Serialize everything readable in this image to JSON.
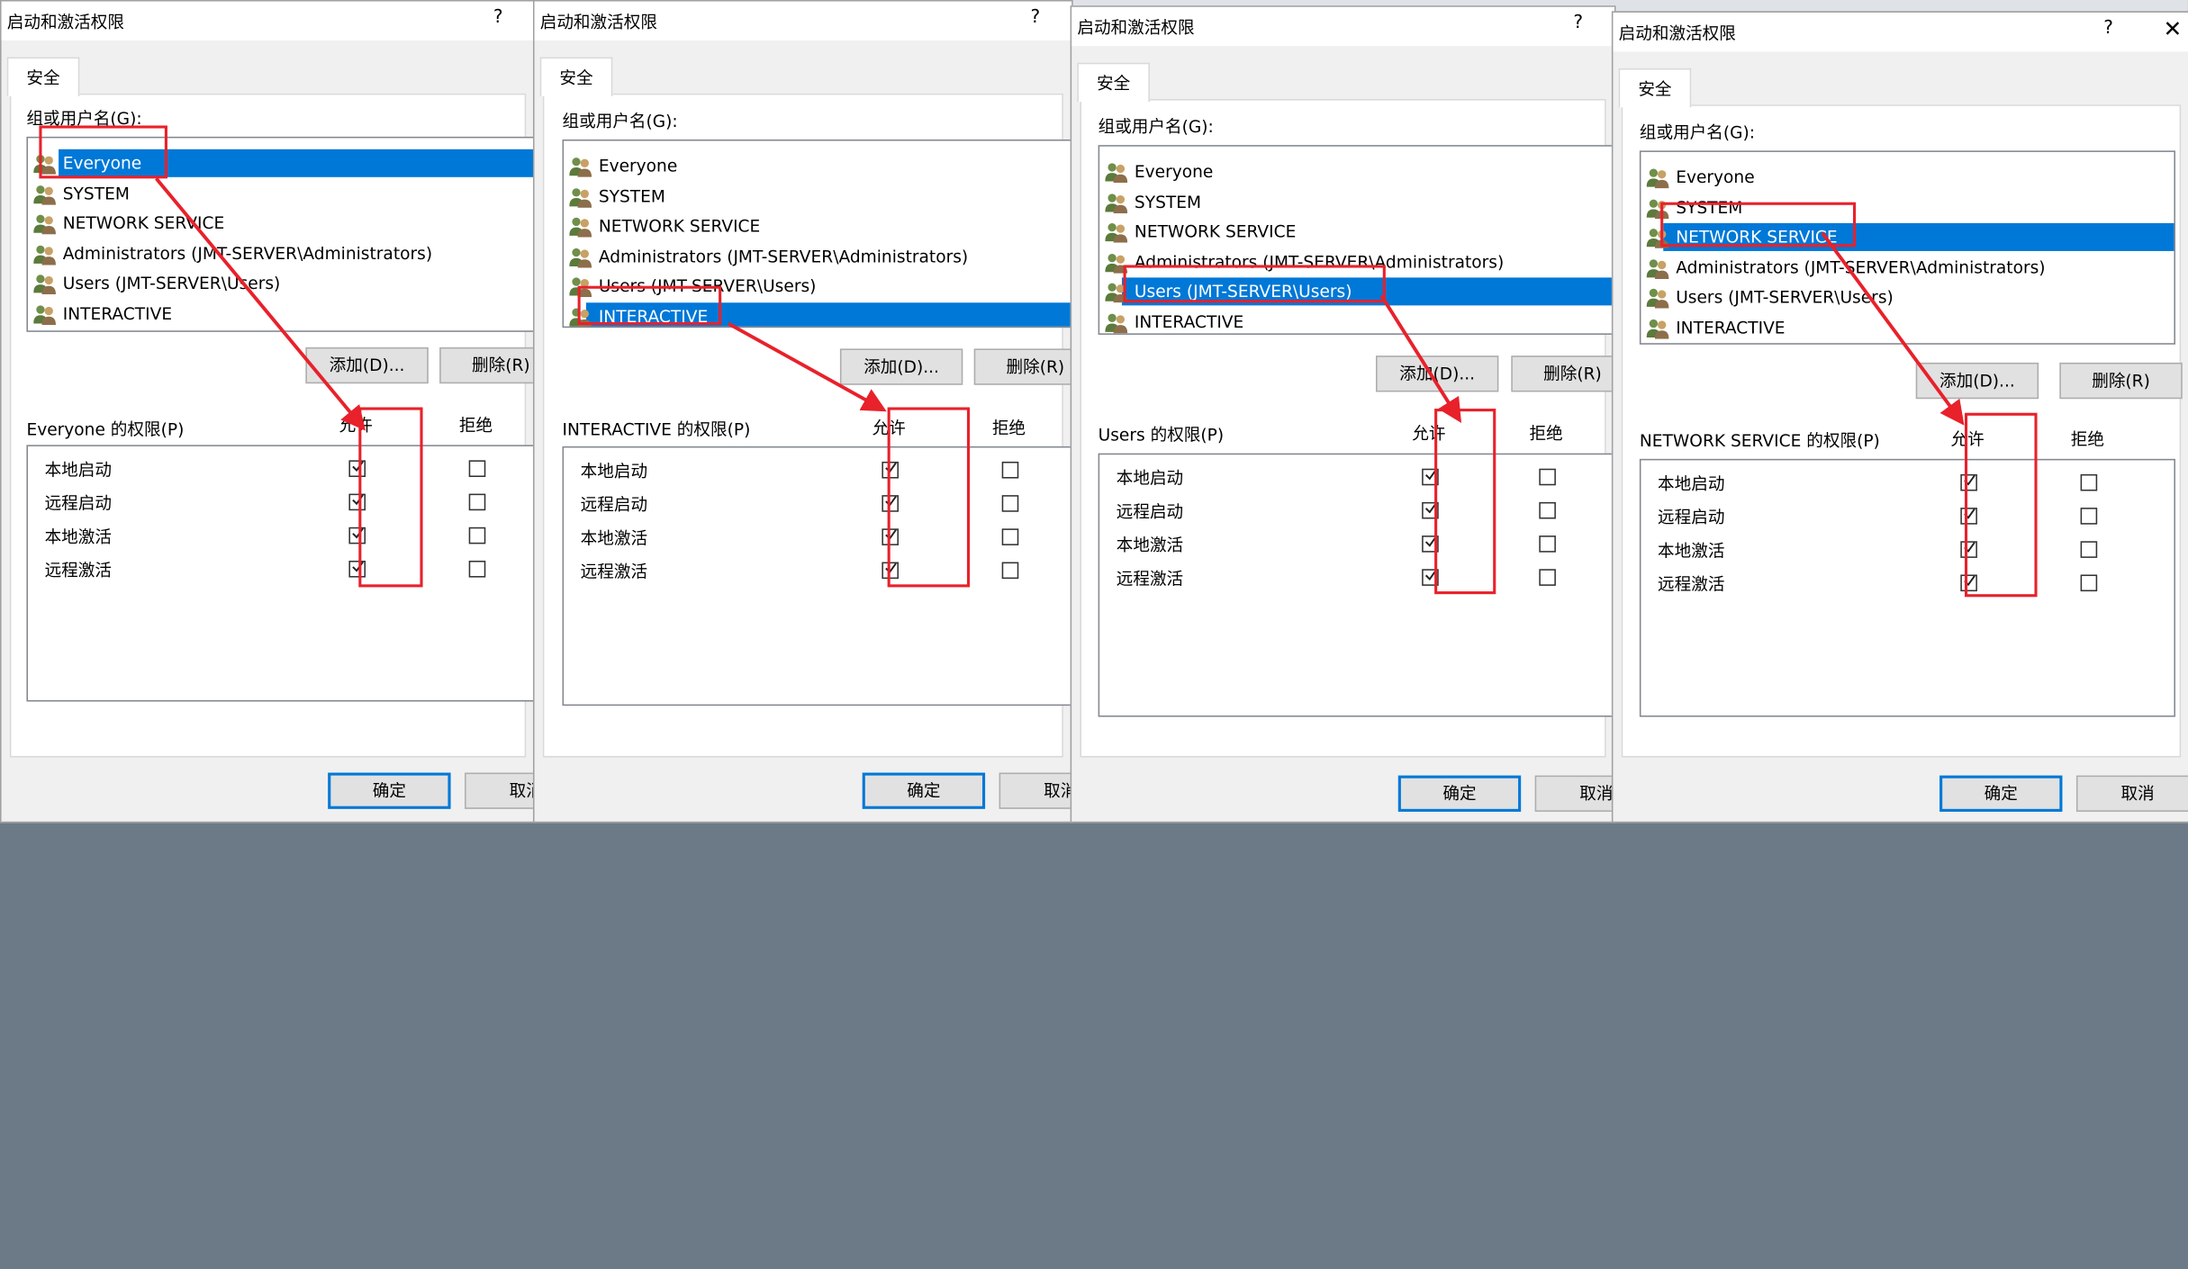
{
  "dialogs": [
    {
      "title": "启动和激活权限",
      "help": "?",
      "tab": "安全",
      "group_label": "组或用户名(G):",
      "users": [
        "Everyone",
        "SYSTEM",
        "NETWORK SERVICE",
        "Administrators (JMT-SERVER\\Administrators)",
        "Users (JMT-SERVER\\Users)",
        "INTERACTIVE"
      ],
      "selected": 0,
      "add": "添加(D)...",
      "remove": "删除(R)",
      "perm_label": "Everyone 的权限(P)",
      "allow": "允许",
      "deny": "拒绝",
      "perms": [
        "本地启动",
        "远程启动",
        "本地激活",
        "远程激活"
      ],
      "ok": "确定",
      "cancel": "取消"
    },
    {
      "title": "启动和激活权限",
      "help": "?",
      "tab": "安全",
      "group_label": "组或用户名(G):",
      "users": [
        "Everyone",
        "SYSTEM",
        "NETWORK SERVICE",
        "Administrators (JMT-SERVER\\Administrators)",
        "Users (JMT-SERVER\\Users)",
        "INTERACTIVE"
      ],
      "selected": 5,
      "add": "添加(D)...",
      "remove": "删除(R)",
      "perm_label": "INTERACTIVE 的权限(P)",
      "allow": "允许",
      "deny": "拒绝",
      "perms": [
        "本地启动",
        "远程启动",
        "本地激活",
        "远程激活"
      ],
      "ok": "确定",
      "cancel": "取消"
    },
    {
      "title": "启动和激活权限",
      "help": "?",
      "tab": "安全",
      "group_label": "组或用户名(G):",
      "users": [
        "Everyone",
        "SYSTEM",
        "NETWORK SERVICE",
        "Administrators (JMT-SERVER\\Administrators)",
        "Users (JMT-SERVER\\Users)",
        "INTERACTIVE"
      ],
      "selected": 4,
      "add": "添加(D)...",
      "remove": "删除(R)",
      "perm_label": "Users 的权限(P)",
      "allow": "允许",
      "deny": "拒绝",
      "perms": [
        "本地启动",
        "远程启动",
        "本地激活",
        "远程激活"
      ],
      "ok": "确定",
      "cancel": "取消"
    },
    {
      "title": "启动和激活权限",
      "help": "?",
      "close": "✕",
      "tab": "安全",
      "group_label": "组或用户名(G):",
      "users": [
        "Everyone",
        "SYSTEM",
        "NETWORK SERVICE",
        "Administrators (JMT-SERVER\\Administrators)",
        "Users (JMT-SERVER\\Users)",
        "INTERACTIVE"
      ],
      "selected": 2,
      "add": "添加(D)...",
      "remove": "删除(R)",
      "perm_label": "NETWORK SERVICE 的权限(P)",
      "allow": "允许",
      "deny": "拒绝",
      "perms": [
        "本地启动",
        "远程启动",
        "本地激活",
        "远程激活"
      ],
      "ok": "确定",
      "cancel": "取消"
    }
  ],
  "allow_checked": [
    true,
    true,
    true,
    true
  ],
  "deny_checked": [
    false,
    false,
    false,
    false
  ],
  "colors": {
    "selection": "#0078d7",
    "annotation_red": "#e8212b",
    "dialog_bg": "#f0f0f0"
  },
  "icons": {
    "user_group": "users-group-icon",
    "checkbox_tick": "check-icon"
  }
}
